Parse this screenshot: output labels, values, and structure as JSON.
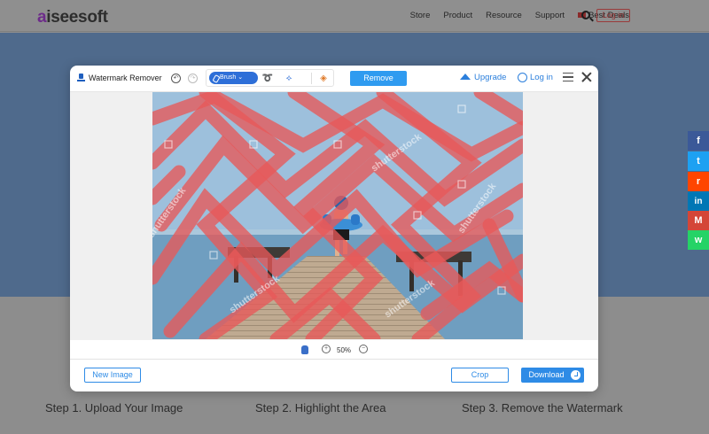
{
  "site": {
    "logo": "aiseesoft",
    "nav": [
      "Store",
      "Product",
      "Resource",
      "Support"
    ],
    "best_deals": "Best Deals",
    "login": "Log in"
  },
  "steps": [
    "Step 1. Upload Your Image",
    "Step 2. Highlight the Area",
    "Step 3. Remove the Watermark"
  ],
  "social": [
    "f",
    "t",
    "r",
    "in",
    "M",
    "w"
  ],
  "modal": {
    "title": "Watermark Remover",
    "brush_label": "Brush",
    "remove_label": "Remove",
    "upgrade_label": "Upgrade",
    "login_label": "Log in",
    "zoom": "50%",
    "new_image_label": "New Image",
    "crop_label": "Crop",
    "download_label": "Download",
    "watermark_text": "shutterstock"
  },
  "colors": {
    "accent": "#2e8be6",
    "highlight": "#e85858",
    "hero": "#4f6a8c"
  }
}
